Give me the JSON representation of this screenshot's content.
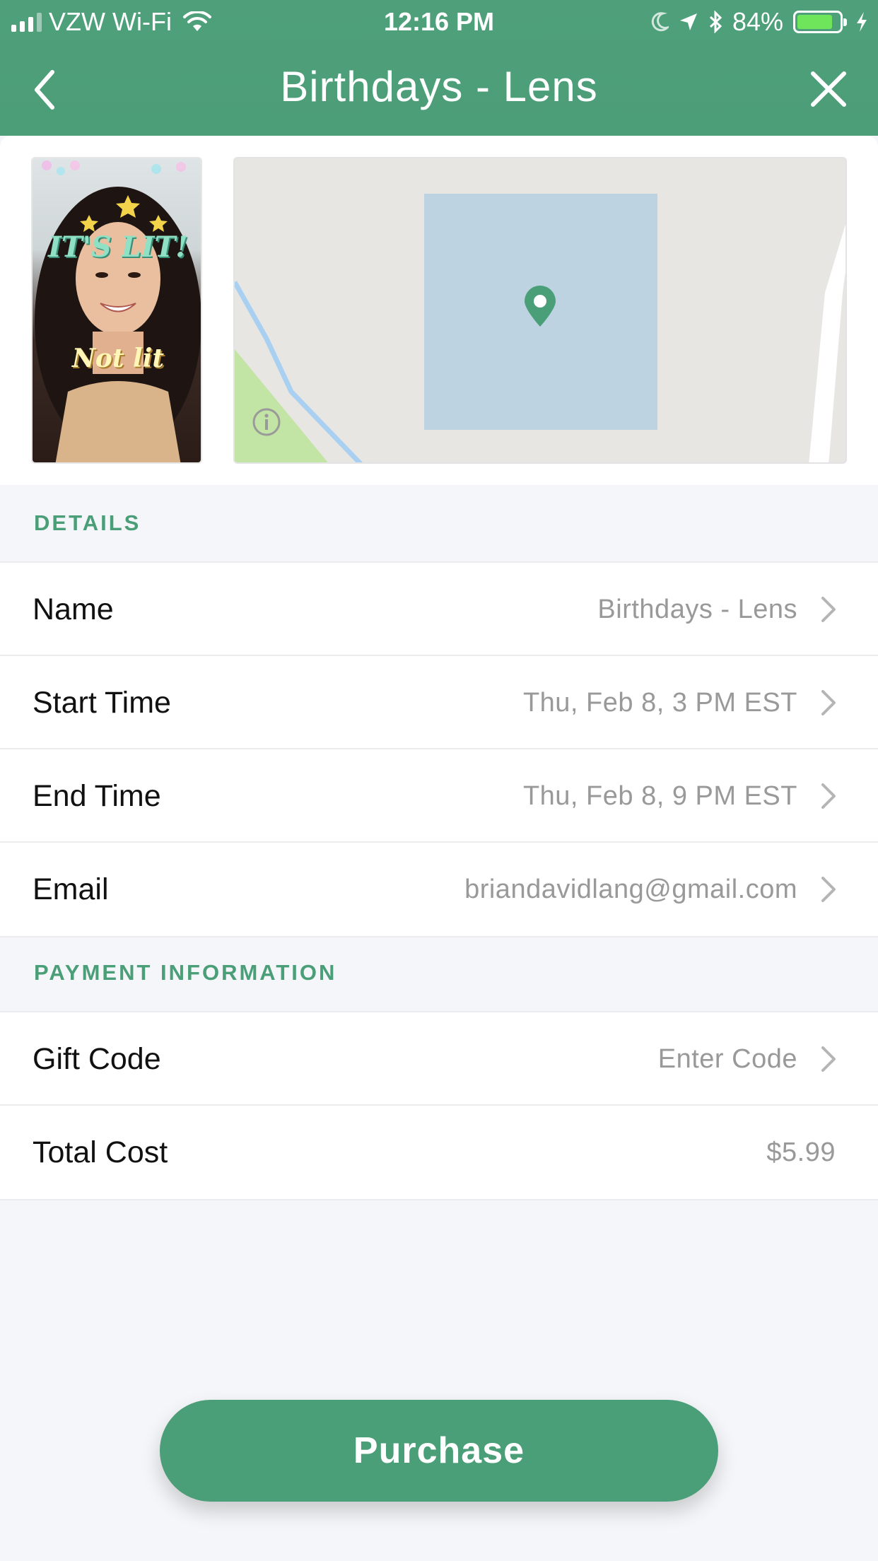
{
  "status_bar": {
    "carrier": "VZW Wi-Fi",
    "time": "12:16 PM",
    "battery_percent": "84%",
    "battery_level": 0.84,
    "icons": [
      "signal-icon",
      "wifi-icon",
      "moon-icon",
      "location-arrow-icon",
      "bluetooth-icon",
      "battery-icon",
      "charging-icon"
    ]
  },
  "nav": {
    "title": "Birthdays - Lens",
    "back_icon": "chevron-left-icon",
    "close_icon": "close-icon"
  },
  "preview": {
    "lens_text_top": "IT'S LIT!",
    "lens_text_bottom": "Not lit",
    "map_pin_icon": "map-pin-icon",
    "map_info_icon": "info-icon"
  },
  "details": {
    "label": "DETAILS",
    "rows": [
      {
        "label": "Name",
        "value": "Birthdays - Lens"
      },
      {
        "label": "Start Time",
        "value": "Thu, Feb 8, 3 PM EST"
      },
      {
        "label": "End Time",
        "value": "Thu, Feb 8, 9 PM EST"
      },
      {
        "label": "Email",
        "value": "briandavidlang@gmail.com"
      }
    ]
  },
  "payment": {
    "label": "PAYMENT INFORMATION",
    "rows": [
      {
        "label": "Gift Code",
        "value": "Enter Code"
      },
      {
        "label": "Total Cost",
        "value": "$5.99"
      }
    ]
  },
  "purchase_button": {
    "label": "Purchase"
  },
  "colors": {
    "brand_green": "#4a9e78",
    "value_gray": "#999999",
    "background": "#f5f6f9"
  }
}
